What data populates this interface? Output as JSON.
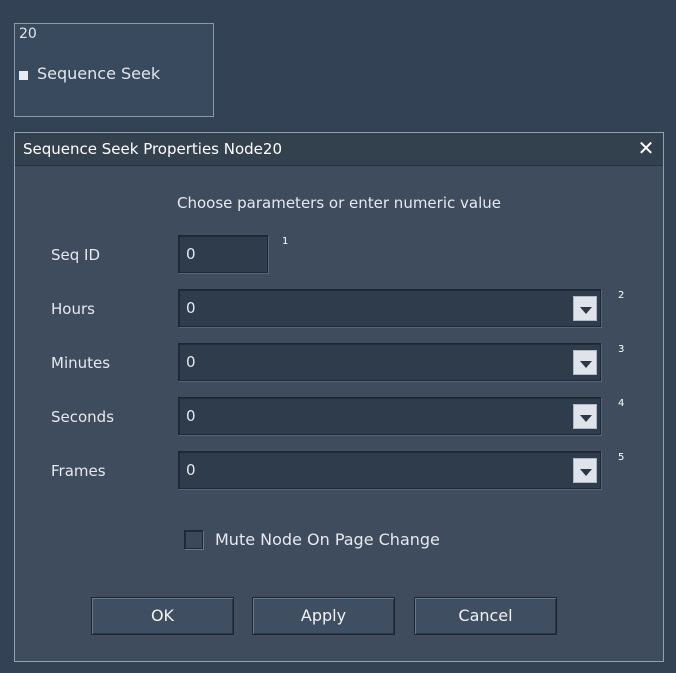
{
  "node": {
    "number": "20",
    "label": "Sequence Seek"
  },
  "dialog": {
    "title": "Sequence Seek Properties Node20",
    "close_glyph": "✕",
    "instruction": "Choose parameters or enter numeric value",
    "fields": [
      {
        "label": "Seq ID",
        "value": "0",
        "index": "1"
      },
      {
        "label": "Hours",
        "value": "0",
        "index": "2"
      },
      {
        "label": "Minutes",
        "value": "0",
        "index": "3"
      },
      {
        "label": "Seconds",
        "value": "0",
        "index": "4"
      },
      {
        "label": "Frames",
        "value": "0",
        "index": "5"
      }
    ],
    "mute_label": "Mute Node On Page Change",
    "mute_checked": false,
    "buttons": {
      "ok": "OK",
      "apply": "Apply",
      "cancel": "Cancel"
    }
  },
  "icons": {
    "close": "close-icon",
    "dropdown": "chevron-down-icon",
    "port": "port-icon"
  }
}
